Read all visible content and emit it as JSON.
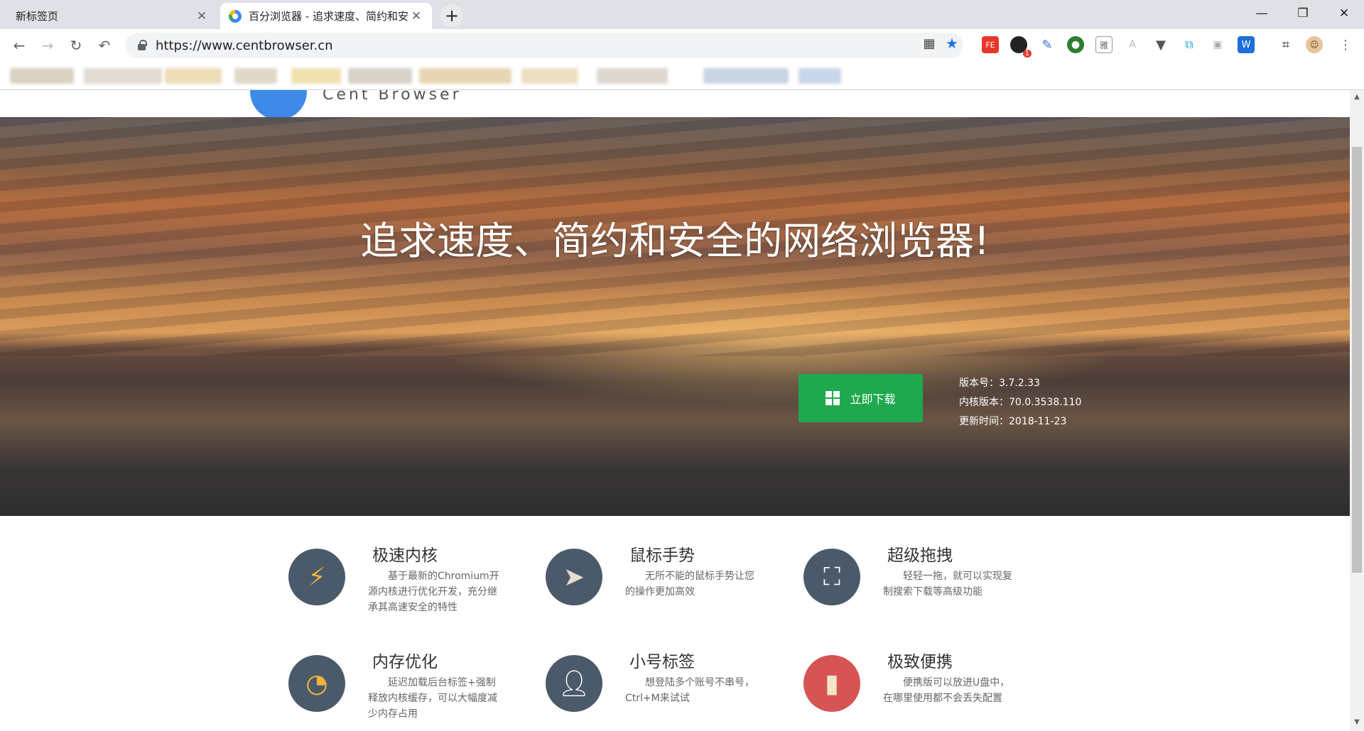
{
  "tabs": [
    {
      "title": "新标签页"
    },
    {
      "title": "百分浏览器 - 追求速度、简约和安全的网络浏览器"
    }
  ],
  "toolbar": {
    "url": "https://www.centbrowser.cn",
    "ext_badge": "1",
    "ext_ya": "雅"
  },
  "logo": {
    "text": "Cent Browser"
  },
  "hero": {
    "title": "追求速度、简约和安全的网络浏览器!",
    "download_label": "立即下载",
    "version": "版本号：3.7.2.33",
    "kernel": "内核版本：70.0.3538.110",
    "updated": "更新时间：2018-11-23"
  },
  "features": [
    {
      "title": "极速内核",
      "desc": "基于最新的Chromium开源内核进行优化开发，充分继承其高速安全的特性",
      "icon": "lightning-icon"
    },
    {
      "title": "鼠标手势",
      "desc": "无所不能的鼠标手势让您的操作更加高效",
      "icon": "cursor-icon"
    },
    {
      "title": "超级拖拽",
      "desc": "轻轻一拖，就可以实现复制搜索下载等高级功能",
      "icon": "drag-icon"
    },
    {
      "title": "内存优化",
      "desc": "延迟加载后台标签+强制释放内核缓存，可以大幅度减少内存占用",
      "icon": "gauge-icon"
    },
    {
      "title": "小号标签",
      "desc": "想登陆多个账号不串号，Ctrl+M来试试",
      "icon": "user-icon"
    },
    {
      "title": "极致便携",
      "desc": "便携版可以放进U盘中，在哪里使用都不会丢失配置",
      "icon": "sd-card-icon"
    }
  ]
}
